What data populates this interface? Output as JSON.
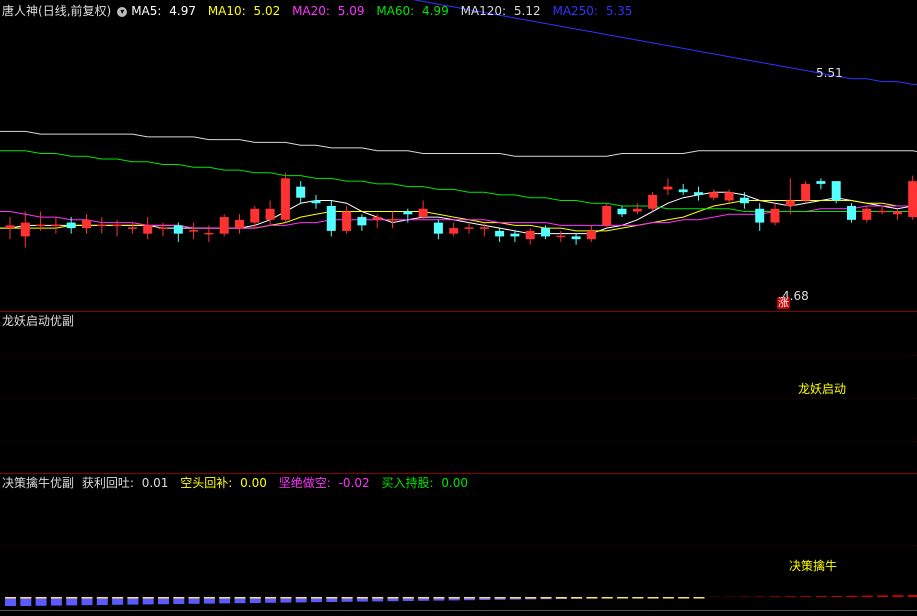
{
  "colors": {
    "up": "#ff3232",
    "down": "#54ffff",
    "grid": "#8a0000",
    "ma5": "#ffffff",
    "ma10": "#ffff00",
    "ma20": "#ff33ff",
    "ma60": "#00e600",
    "ma120": "#d8d8d8",
    "ma250": "#3232ff",
    "magenta_bar": "#ff00ff",
    "red_bar": "#ff0000",
    "yellow": "#ffff00"
  },
  "panel1": {
    "stock": "唐人神",
    "period": "(日线,前复权)",
    "ma5_label": "MA5:",
    "ma5_value": "4.97",
    "ma10_label": "MA10:",
    "ma10_value": "5.02",
    "ma20_label": "MA20:",
    "ma20_value": "5.09",
    "ma60_label": "MA60:",
    "ma60_value": "4.99",
    "ma120_label": "MA120:",
    "ma120_value": "5.12",
    "ma250_label": "MA250:",
    "ma250_value": "5.35",
    "high_marker": "5.51",
    "low_marker": "4.68",
    "zhang_badge": "涨"
  },
  "panel2": {
    "title": "龙妖启动优副",
    "signal_label": "龙妖启动"
  },
  "panel3": {
    "title": "决策擒牛优副",
    "v1_label": "获利回吐:",
    "v1_value": "0.01",
    "v2_label": "空头回补:",
    "v2_value": "0.00",
    "v3_label": "坚绝做空:",
    "v3_value": "-0.02",
    "v4_label": "买入持股:",
    "v4_value": "0.00",
    "signal_label": "决策擒牛"
  },
  "chart_data": {
    "type": "candlestick",
    "price_range": [
      4.6,
      5.62
    ],
    "high_point": 5.51,
    "low_point": 4.68,
    "candles": [
      [
        4.86,
        4.87,
        4.82,
        4.9
      ],
      [
        4.83,
        4.88,
        4.79,
        4.92
      ],
      [
        4.87,
        4.87,
        4.85,
        4.92
      ],
      [
        4.87,
        4.87,
        4.84,
        4.9
      ],
      [
        4.88,
        4.86,
        4.84,
        4.9
      ],
      [
        4.86,
        4.89,
        4.84,
        4.91
      ],
      [
        4.87,
        4.87,
        4.84,
        4.9
      ],
      [
        4.87,
        4.87,
        4.83,
        4.89
      ],
      [
        4.86,
        4.86,
        4.84,
        4.88
      ],
      [
        4.84,
        4.87,
        4.82,
        4.9
      ],
      [
        4.86,
        4.86,
        4.83,
        4.88
      ],
      [
        4.87,
        4.84,
        4.81,
        4.88
      ],
      [
        4.85,
        4.85,
        4.82,
        4.88
      ],
      [
        4.84,
        4.84,
        4.81,
        4.87
      ],
      [
        4.84,
        4.9,
        4.83,
        4.91
      ],
      [
        4.86,
        4.89,
        4.84,
        4.91
      ],
      [
        4.88,
        4.93,
        4.86,
        4.94
      ],
      [
        4.89,
        4.93,
        4.87,
        4.96
      ],
      [
        4.89,
        5.04,
        4.88,
        5.06
      ],
      [
        5.01,
        4.97,
        4.95,
        5.03
      ],
      [
        4.96,
        4.95,
        4.93,
        4.98
      ],
      [
        4.94,
        4.85,
        4.83,
        4.96
      ],
      [
        4.85,
        4.92,
        4.84,
        4.94
      ],
      [
        4.9,
        4.87,
        4.85,
        4.91
      ],
      [
        4.89,
        4.9,
        4.86,
        4.91
      ],
      [
        4.89,
        4.89,
        4.86,
        4.92
      ],
      [
        4.92,
        4.91,
        4.88,
        4.93
      ],
      [
        4.9,
        4.93,
        4.89,
        4.96
      ],
      [
        4.88,
        4.84,
        4.82,
        4.89
      ],
      [
        4.84,
        4.86,
        4.83,
        4.88
      ],
      [
        4.86,
        4.86,
        4.84,
        4.88
      ],
      [
        4.86,
        4.86,
        4.83,
        4.88
      ],
      [
        4.85,
        4.83,
        4.81,
        4.86
      ],
      [
        4.84,
        4.83,
        4.81,
        4.85
      ],
      [
        4.82,
        4.85,
        4.8,
        4.86
      ],
      [
        4.86,
        4.83,
        4.82,
        4.87
      ],
      [
        4.83,
        4.83,
        4.81,
        4.85
      ],
      [
        4.83,
        4.82,
        4.8,
        4.84
      ],
      [
        4.82,
        4.85,
        4.81,
        4.87
      ],
      [
        4.87,
        4.94,
        4.86,
        4.95
      ],
      [
        4.93,
        4.91,
        4.9,
        4.94
      ],
      [
        4.92,
        4.93,
        4.91,
        4.95
      ],
      [
        4.93,
        4.98,
        4.92,
        4.99
      ],
      [
        5.0,
        5.01,
        4.98,
        5.04
      ],
      [
        5.0,
        4.99,
        4.98,
        5.02
      ],
      [
        4.99,
        4.98,
        4.96,
        5.01
      ],
      [
        4.97,
        4.99,
        4.96,
        5.0
      ],
      [
        4.96,
        4.99,
        4.95,
        5.0
      ],
      [
        4.97,
        4.95,
        4.93,
        4.99
      ],
      [
        4.93,
        4.88,
        4.85,
        4.95
      ],
      [
        4.88,
        4.93,
        4.87,
        4.95
      ],
      [
        4.94,
        4.96,
        4.91,
        5.04
      ],
      [
        4.96,
        5.02,
        4.95,
        5.03
      ],
      [
        5.03,
        5.02,
        5.0,
        5.04
      ],
      [
        5.03,
        4.96,
        4.95,
        5.03
      ],
      [
        4.94,
        4.89,
        4.88,
        4.95
      ],
      [
        4.89,
        4.93,
        4.88,
        4.94
      ],
      [
        4.92,
        4.92,
        4.91,
        4.94
      ],
      [
        4.91,
        4.92,
        4.89,
        4.93
      ],
      [
        4.9,
        5.03,
        4.89,
        5.05
      ],
      [
        5.0,
        4.77,
        4.75,
        5.08
      ],
      [
        4.9,
        5.29,
        4.68,
        5.31
      ],
      [
        5.29,
        5.35,
        5.25,
        5.4
      ],
      [
        5.41,
        5.23,
        5.16,
        5.51
      ],
      [
        5.36,
        5.21,
        5.19,
        5.36
      ],
      [
        5.24,
        5.2,
        5.18,
        5.25
      ],
      [
        5.2,
        5.17,
        5.15,
        5.23
      ],
      [
        5.19,
        5.16,
        5.14,
        5.26
      ],
      [
        5.16,
        5.15,
        5.09,
        5.19
      ],
      [
        5.17,
        5.1,
        5.09,
        5.23
      ],
      [
        5.09,
        5.09,
        5.06,
        5.12
      ]
    ],
    "ma_series": {
      "MA5": [
        4.86,
        4.87,
        4.87,
        4.87,
        4.87,
        4.87,
        4.87,
        4.87,
        4.87,
        4.87,
        4.86,
        4.86,
        4.86,
        4.86,
        4.86,
        4.86,
        4.87,
        4.89,
        4.92,
        4.95,
        4.96,
        4.96,
        4.95,
        4.92,
        4.9,
        4.88,
        4.89,
        4.9,
        4.9,
        4.89,
        4.88,
        4.87,
        4.86,
        4.85,
        4.84,
        4.84,
        4.84,
        4.84,
        4.84,
        4.86,
        4.87,
        4.89,
        4.92,
        4.95,
        4.97,
        4.98,
        4.99,
        4.99,
        4.98,
        4.96,
        4.95,
        4.94,
        4.95,
        4.96,
        4.97,
        4.96,
        4.95,
        4.94,
        4.93,
        4.94,
        4.92,
        4.98,
        5.06,
        5.13,
        5.18,
        5.22,
        5.23,
        5.2,
        5.18,
        5.16,
        5.13
      ],
      "MA10": [
        4.86,
        4.86,
        4.86,
        4.86,
        4.87,
        4.87,
        4.87,
        4.87,
        4.87,
        4.87,
        4.87,
        4.87,
        4.86,
        4.86,
        4.86,
        4.86,
        4.86,
        4.87,
        4.88,
        4.9,
        4.91,
        4.92,
        4.92,
        4.92,
        4.92,
        4.92,
        4.92,
        4.92,
        4.91,
        4.9,
        4.89,
        4.88,
        4.88,
        4.87,
        4.87,
        4.86,
        4.86,
        4.85,
        4.85,
        4.85,
        4.86,
        4.87,
        4.88,
        4.89,
        4.9,
        4.92,
        4.94,
        4.95,
        4.96,
        4.96,
        4.96,
        4.96,
        4.96,
        4.96,
        4.96,
        4.96,
        4.95,
        4.95,
        4.94,
        4.94,
        4.93,
        4.95,
        4.98,
        5.02,
        5.05,
        5.08,
        5.1,
        5.11,
        5.11,
        5.11,
        5.1
      ],
      "MA20": [
        4.92,
        4.91,
        4.9,
        4.9,
        4.89,
        4.89,
        4.88,
        4.88,
        4.88,
        4.87,
        4.87,
        4.87,
        4.86,
        4.86,
        4.86,
        4.86,
        4.86,
        4.87,
        4.87,
        4.88,
        4.88,
        4.89,
        4.89,
        4.89,
        4.89,
        4.89,
        4.89,
        4.89,
        4.89,
        4.89,
        4.89,
        4.89,
        4.88,
        4.88,
        4.88,
        4.88,
        4.87,
        4.87,
        4.87,
        4.87,
        4.87,
        4.87,
        4.88,
        4.88,
        4.89,
        4.89,
        4.9,
        4.91,
        4.91,
        4.91,
        4.92,
        4.92,
        4.92,
        4.93,
        4.93,
        4.93,
        4.94,
        4.94,
        4.94,
        4.94,
        4.94,
        4.95,
        4.96,
        4.98,
        4.99,
        5.01,
        5.02,
        5.03,
        5.04,
        5.05,
        5.06
      ],
      "MA60": [
        5.14,
        5.14,
        5.13,
        5.13,
        5.12,
        5.12,
        5.11,
        5.11,
        5.1,
        5.1,
        5.09,
        5.09,
        5.08,
        5.08,
        5.07,
        5.07,
        5.06,
        5.06,
        5.05,
        5.05,
        5.04,
        5.04,
        5.03,
        5.03,
        5.02,
        5.02,
        5.01,
        5.01,
        5.0,
        5.0,
        4.99,
        4.99,
        4.98,
        4.98,
        4.97,
        4.97,
        4.96,
        4.96,
        4.95,
        4.95,
        4.94,
        4.94,
        4.94,
        4.93,
        4.93,
        4.93,
        4.93,
        4.93,
        4.92,
        4.92,
        4.92,
        4.92,
        4.92,
        4.92,
        4.92,
        4.92,
        4.92,
        4.92,
        4.92,
        4.92,
        4.92,
        4.93,
        4.94,
        4.95,
        4.96,
        4.96,
        4.97,
        4.97,
        4.98,
        4.98,
        4.99
      ],
      "MA120": [
        5.21,
        5.21,
        5.2,
        5.2,
        5.2,
        5.2,
        5.2,
        5.2,
        5.2,
        5.19,
        5.19,
        5.19,
        5.19,
        5.18,
        5.18,
        5.18,
        5.17,
        5.17,
        5.17,
        5.16,
        5.16,
        5.15,
        5.15,
        5.15,
        5.14,
        5.14,
        5.14,
        5.13,
        5.13,
        5.13,
        5.13,
        5.13,
        5.13,
        5.12,
        5.12,
        5.12,
        5.12,
        5.12,
        5.12,
        5.12,
        5.13,
        5.13,
        5.13,
        5.13,
        5.13,
        5.14,
        5.14,
        5.14,
        5.14,
        5.14,
        5.14,
        5.14,
        5.14,
        5.14,
        5.14,
        5.14,
        5.14,
        5.14,
        5.14,
        5.14,
        5.13,
        5.13,
        5.13,
        5.13,
        5.13,
        5.13,
        5.12,
        5.12,
        5.12,
        5.12,
        5.12
      ],
      "MA250": [
        5.95,
        5.94,
        5.93,
        5.92,
        5.91,
        5.9,
        5.89,
        5.88,
        5.87,
        5.86,
        5.85,
        5.84,
        5.83,
        5.82,
        5.81,
        5.8,
        5.79,
        5.78,
        5.77,
        5.76,
        5.75,
        5.74,
        5.73,
        5.72,
        5.71,
        5.7,
        5.69,
        5.68,
        5.67,
        5.66,
        5.65,
        5.64,
        5.63,
        5.62,
        5.61,
        5.6,
        5.59,
        5.58,
        5.57,
        5.56,
        5.55,
        5.54,
        5.53,
        5.52,
        5.51,
        5.5,
        5.49,
        5.48,
        5.47,
        5.46,
        5.45,
        5.44,
        5.43,
        5.42,
        5.41,
        5.4,
        5.4,
        5.39,
        5.39,
        5.38,
        5.38,
        5.38,
        5.37,
        5.37,
        5.37,
        5.36,
        5.36,
        5.36,
        5.35,
        5.35,
        5.35
      ]
    },
    "signal_index": 63,
    "bottom_bars": [
      -0.9,
      -0.9,
      -0.88,
      -0.86,
      -0.84,
      -0.82,
      -0.8,
      -0.78,
      -0.76,
      -0.74,
      -0.72,
      -0.7,
      -0.68,
      -0.66,
      -0.64,
      -0.62,
      -0.6,
      -0.58,
      -0.56,
      -0.54,
      -0.52,
      -0.5,
      -0.48,
      -0.46,
      -0.44,
      -0.42,
      -0.4,
      -0.38,
      -0.36,
      -0.34,
      -0.32,
      -0.3,
      -0.28,
      -0.26,
      -0.24,
      -0.22,
      -0.2,
      -0.18,
      -0.16,
      -0.14,
      -0.12,
      -0.1,
      -0.08,
      -0.06,
      -0.04,
      -0.02,
      0.02,
      0.03,
      0.04,
      0.05,
      0.06,
      0.07,
      0.08,
      0.09,
      0.1,
      0.12,
      0.14,
      0.16,
      0.18,
      0.2,
      0.22,
      0.25,
      0.28,
      0.3,
      0.32,
      0.34,
      0.36,
      0.38,
      0.4,
      0.4,
      0.4
    ]
  }
}
